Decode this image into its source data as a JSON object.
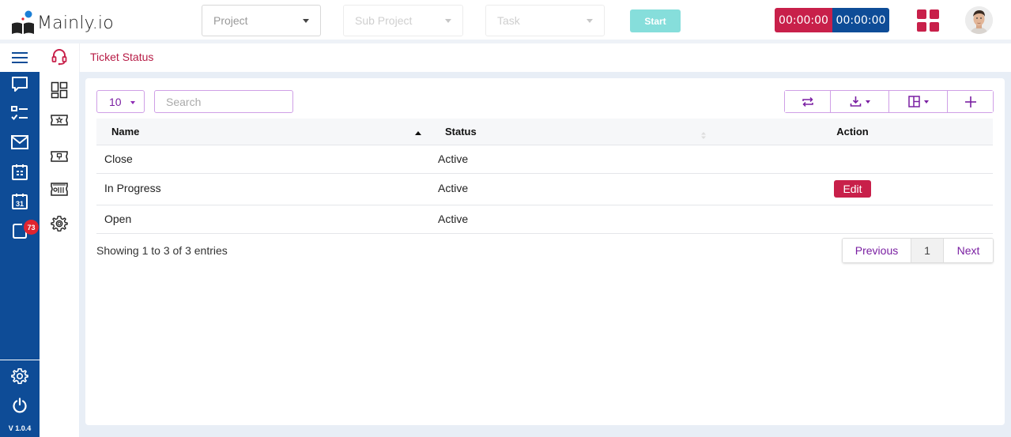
{
  "app": {
    "name": "Mainly.io",
    "version": "V 1.0.4"
  },
  "header": {
    "project_placeholder": "Project",
    "subproject_placeholder": "Sub Project",
    "task_placeholder": "Task",
    "start_label": "Start",
    "timer_today": "00:00:00",
    "timer_total": "00:00:00",
    "apps_icon": "grid-icon",
    "avatar": "user-avatar"
  },
  "rail": {
    "items": [
      {
        "name": "menu",
        "icon": "hamburger-icon"
      },
      {
        "name": "chat",
        "icon": "chat-icon"
      },
      {
        "name": "tasks",
        "icon": "checklist-icon"
      },
      {
        "name": "mail",
        "icon": "mail-icon"
      },
      {
        "name": "planner",
        "icon": "calendar-grid-icon"
      },
      {
        "name": "calendar",
        "icon": "calendar-31-icon"
      },
      {
        "name": "notifications",
        "icon": "notification-icon",
        "badge": "73"
      },
      {
        "name": "settings",
        "icon": "gear-icon"
      },
      {
        "name": "logout",
        "icon": "power-icon"
      }
    ]
  },
  "subrail": {
    "items": [
      {
        "name": "support",
        "icon": "headset-icon",
        "active": true
      },
      {
        "name": "dashboard",
        "icon": "dashboard-icon"
      },
      {
        "name": "ticket-category",
        "icon": "ticket-star-icon"
      },
      {
        "name": "ticket-priority",
        "icon": "ticket-pin-icon"
      },
      {
        "name": "ticket-status",
        "icon": "ticket-status-icon"
      },
      {
        "name": "support-settings",
        "icon": "gear-icon"
      }
    ]
  },
  "page": {
    "title": "Ticket Status",
    "page_length": "10",
    "search_placeholder": "Search",
    "toolbar": [
      {
        "name": "reload",
        "icon": "refresh-icon"
      },
      {
        "name": "export",
        "icon": "download-icon"
      },
      {
        "name": "columns",
        "icon": "columns-icon"
      },
      {
        "name": "add",
        "icon": "plus-icon"
      }
    ],
    "table": {
      "columns": [
        "Name",
        "Status",
        "Action"
      ],
      "rows": [
        {
          "name": "Close",
          "status": "Active",
          "action": ""
        },
        {
          "name": "In Progress",
          "status": "Active",
          "action": "Edit"
        },
        {
          "name": "Open",
          "status": "Active",
          "action": ""
        }
      ]
    },
    "info": "Showing 1 to 3 of 3 entries",
    "pagination": {
      "previous": "Previous",
      "current": "1",
      "next": "Next"
    }
  },
  "colors": {
    "brand_blue": "#0e4c97",
    "accent_red": "#c8204a",
    "accent_purple": "#7a1fa2",
    "start_teal": "#86dedb"
  }
}
